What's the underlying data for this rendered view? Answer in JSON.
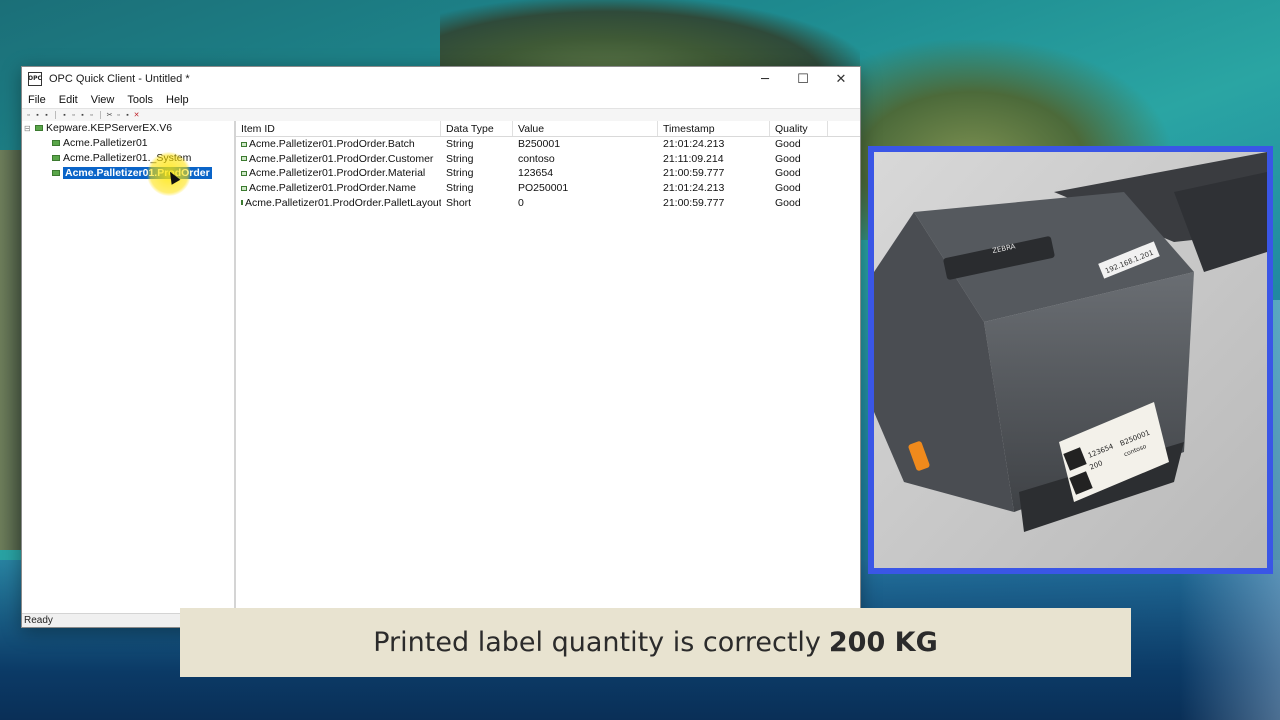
{
  "window": {
    "title": "OPC Quick Client - Untitled *",
    "icon_text": "OPC",
    "controls": {
      "minimize": "─",
      "maximize": "☐",
      "close": "✕"
    }
  },
  "menu": [
    "File",
    "Edit",
    "View",
    "Tools",
    "Help"
  ],
  "tree": {
    "root": "Kepware.KEPServerEX.V6",
    "items": [
      {
        "label": "Acme.Palletizer01"
      },
      {
        "label": "Acme.Palletizer01._System"
      },
      {
        "label": "Acme.Palletizer01.ProdOrder",
        "selected": true
      }
    ]
  },
  "table": {
    "columns": [
      "Item ID",
      "Data Type",
      "Value",
      "Timestamp",
      "Quality"
    ],
    "rows": [
      [
        "Acme.Palletizer01.ProdOrder.Batch",
        "String",
        "B250001",
        "21:01:24.213",
        "Good"
      ],
      [
        "Acme.Palletizer01.ProdOrder.Customer",
        "String",
        "contoso",
        "21:11:09.214",
        "Good"
      ],
      [
        "Acme.Palletizer01.ProdOrder.Material",
        "String",
        "123654",
        "21:00:59.777",
        "Good"
      ],
      [
        "Acme.Palletizer01.ProdOrder.Name",
        "String",
        "PO250001",
        "21:01:24.213",
        "Good"
      ],
      [
        "Acme.Palletizer01.ProdOrder.PalletLayout",
        "Short",
        "0",
        "21:00:59.777",
        "Good"
      ]
    ]
  },
  "status": "Ready",
  "printer_photo": {
    "ip_sticker": "192.168.1.201",
    "brand": "ZEBRA",
    "label_lines": [
      "123654",
      "B250001",
      "contoso",
      "200"
    ]
  },
  "caption": {
    "text": "Printed label quantity is correctly",
    "emphasis": "200 KG"
  },
  "colors": {
    "inset_border": "#3a56e6",
    "selection": "#0a64c8",
    "caption_bg": "#e8e3d0"
  }
}
